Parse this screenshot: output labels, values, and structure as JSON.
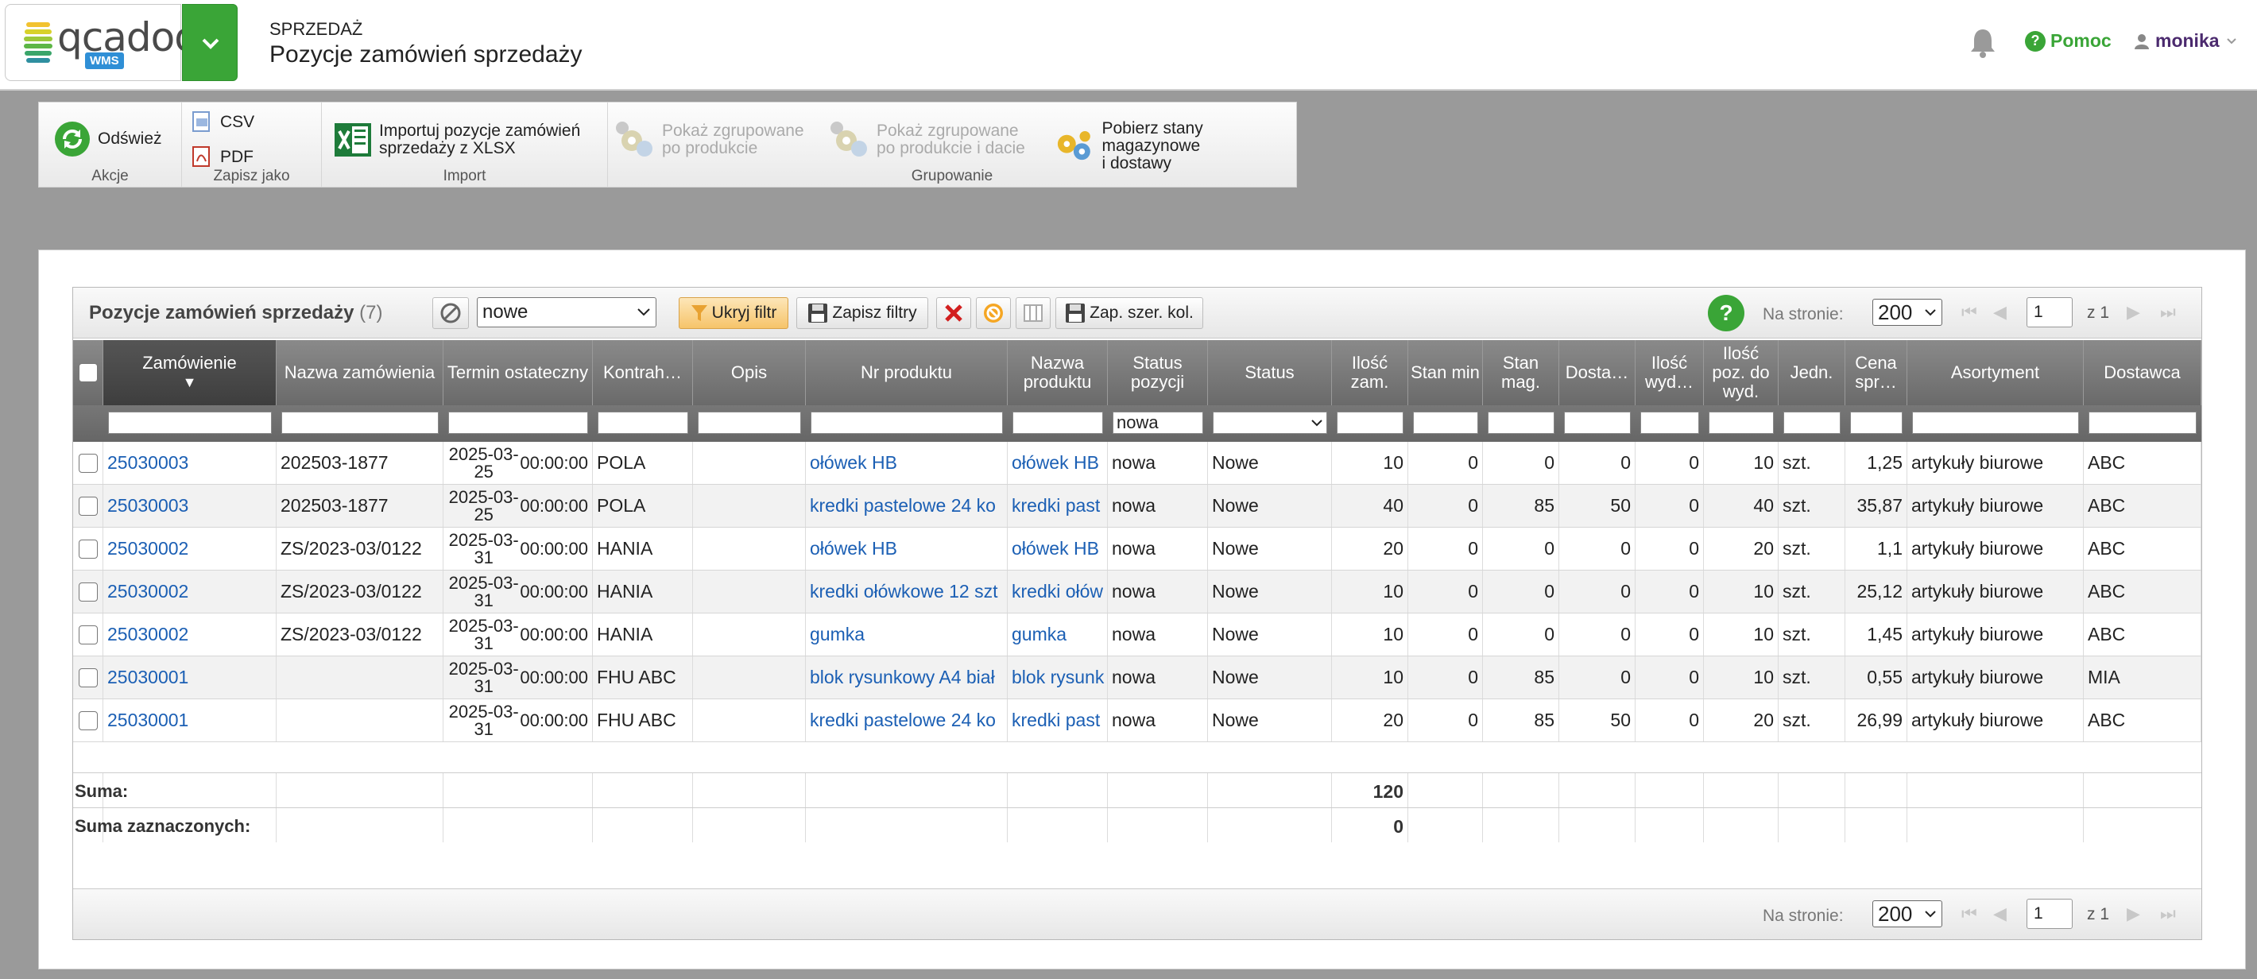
{
  "header": {
    "logo_text": "qcadoo",
    "logo_badge": "WMS",
    "section": "SPRZEDAŻ",
    "title": "Pozycje zamówień sprzedaży",
    "help_label": "Pomoc",
    "user_name": "monika"
  },
  "toolbar": {
    "refresh_label": "Odśwież",
    "csv_label": "CSV",
    "pdf_label": "PDF",
    "import_line1": "Importuj pozycje zamówień",
    "import_line2": "sprzedaży z XLSX",
    "grouped_product_line1": "Pokaż zgrupowane",
    "grouped_product_line2": "po produkcie",
    "grouped_date_line1": "Pokaż zgrupowane",
    "grouped_date_line2": "po produkcie i dacie",
    "stock_line1": "Pobierz stany magazynowe",
    "stock_line2": "i dostawy",
    "groups": {
      "actions": "Akcje",
      "save_as": "Zapisz jako",
      "import": "Import",
      "grouping": "Grupowanie"
    }
  },
  "grid": {
    "title": "Pozycje zamówień sprzedaży",
    "count": "(7)",
    "filter_select": "nowe",
    "hide_filter": "Ukryj filtr",
    "save_filters": "Zapisz filtry",
    "save_col_width": "Zap. szer. kol.",
    "per_page_label": "Na stronie:",
    "per_page": "200",
    "page": "1",
    "of_pages": "z 1",
    "columns": {
      "order": "Zamówienie",
      "order_name": "Nazwa zamówienia",
      "deadline": "Termin ostateczny",
      "contractor": "Kontrah…",
      "description": "Opis",
      "product_number": "Nr produktu",
      "product_name": "Nazwa produktu",
      "position_status": "Status pozycji",
      "status": "Status",
      "qty_ordered": "Ilość zam.",
      "stock_min": "Stan min",
      "stock_mag": "Stan mag.",
      "delivery": "Dosta…",
      "qty_issued": "Ilość wyd…",
      "qty_to_issue": "Ilość poz. do wyd.",
      "unit": "Jedn.",
      "price": "Cena spr…",
      "assortment": "Asortyment",
      "supplier": "Dostawca"
    },
    "filter_position_status": "nowa",
    "rows": [
      {
        "order": "25030003",
        "order_name": "202503-1877",
        "date": "2025-03-25",
        "time": "00:00:00",
        "contractor": "POLA",
        "description": "",
        "product_number": "ołówek HB",
        "product_name": "ołówek HB",
        "position_status": "nowa",
        "status": "Nowe",
        "qty_ordered": "10",
        "stock_min": "0",
        "stock_mag": "0",
        "delivery": "0",
        "qty_issued": "0",
        "qty_to_issue": "10",
        "unit": "szt.",
        "price": "1,25",
        "assortment": "artykuły biurowe",
        "supplier": "ABC"
      },
      {
        "order": "25030003",
        "order_name": "202503-1877",
        "date": "2025-03-25",
        "time": "00:00:00",
        "contractor": "POLA",
        "description": "",
        "product_number": "kredki pastelowe 24 ko",
        "product_name": "kredki past",
        "position_status": "nowa",
        "status": "Nowe",
        "qty_ordered": "40",
        "stock_min": "0",
        "stock_mag": "85",
        "delivery": "50",
        "qty_issued": "0",
        "qty_to_issue": "40",
        "unit": "szt.",
        "price": "35,87",
        "assortment": "artykuły biurowe",
        "supplier": "ABC"
      },
      {
        "order": "25030002",
        "order_name": "ZS/2023-03/0122",
        "date": "2025-03-31",
        "time": "00:00:00",
        "contractor": "HANIA",
        "description": "",
        "product_number": "ołówek HB",
        "product_name": "ołówek HB",
        "position_status": "nowa",
        "status": "Nowe",
        "qty_ordered": "20",
        "stock_min": "0",
        "stock_mag": "0",
        "delivery": "0",
        "qty_issued": "0",
        "qty_to_issue": "20",
        "unit": "szt.",
        "price": "1,1",
        "assortment": "artykuły biurowe",
        "supplier": "ABC"
      },
      {
        "order": "25030002",
        "order_name": "ZS/2023-03/0122",
        "date": "2025-03-31",
        "time": "00:00:00",
        "contractor": "HANIA",
        "description": "",
        "product_number": "kredki ołówkowe 12 szt",
        "product_name": "kredki ołów",
        "position_status": "nowa",
        "status": "Nowe",
        "qty_ordered": "10",
        "stock_min": "0",
        "stock_mag": "0",
        "delivery": "0",
        "qty_issued": "0",
        "qty_to_issue": "10",
        "unit": "szt.",
        "price": "25,12",
        "assortment": "artykuły biurowe",
        "supplier": "ABC"
      },
      {
        "order": "25030002",
        "order_name": "ZS/2023-03/0122",
        "date": "2025-03-31",
        "time": "00:00:00",
        "contractor": "HANIA",
        "description": "",
        "product_number": "gumka",
        "product_name": "gumka",
        "position_status": "nowa",
        "status": "Nowe",
        "qty_ordered": "10",
        "stock_min": "0",
        "stock_mag": "0",
        "delivery": "0",
        "qty_issued": "0",
        "qty_to_issue": "10",
        "unit": "szt.",
        "price": "1,45",
        "assortment": "artykuły biurowe",
        "supplier": "ABC"
      },
      {
        "order": "25030001",
        "order_name": "",
        "date": "2025-03-31",
        "time": "00:00:00",
        "contractor": "FHU ABC",
        "description": "",
        "product_number": "blok rysunkowy A4 biał",
        "product_name": "blok rysunk",
        "position_status": "nowa",
        "status": "Nowe",
        "qty_ordered": "10",
        "stock_min": "0",
        "stock_mag": "85",
        "delivery": "0",
        "qty_issued": "0",
        "qty_to_issue": "10",
        "unit": "szt.",
        "price": "0,55",
        "assortment": "artykuły biurowe",
        "supplier": "MIA"
      },
      {
        "order": "25030001",
        "order_name": "",
        "date": "2025-03-31",
        "time": "00:00:00",
        "contractor": "FHU ABC",
        "description": "",
        "product_number": "kredki pastelowe 24 ko",
        "product_name": "kredki past",
        "position_status": "nowa",
        "status": "Nowe",
        "qty_ordered": "20",
        "stock_min": "0",
        "stock_mag": "85",
        "delivery": "50",
        "qty_issued": "0",
        "qty_to_issue": "20",
        "unit": "szt.",
        "price": "26,99",
        "assortment": "artykuły biurowe",
        "supplier": "ABC"
      }
    ],
    "sum_label": "Suma:",
    "sum_qty": "120",
    "sum_selected_label": "Suma zaznaczonych:",
    "sum_selected_qty": "0"
  }
}
